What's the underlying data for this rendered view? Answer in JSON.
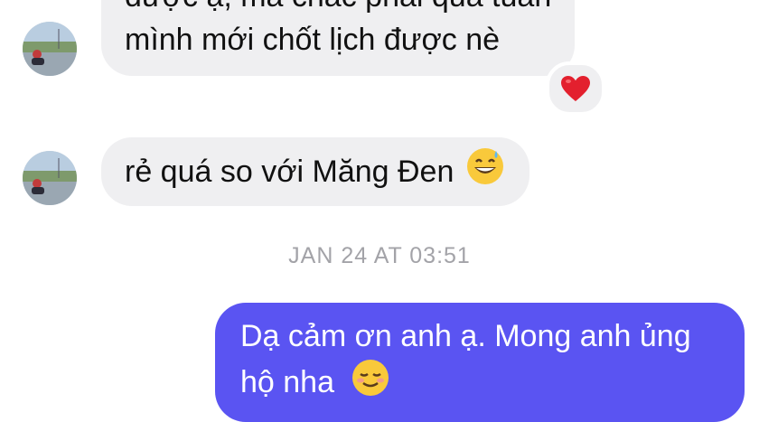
{
  "messages": {
    "first_partial_line": "được ạ, mà chắc phải qua tuần",
    "first_second_line": "mình mới chốt lịch được nè",
    "first_reaction": "heart-emoji",
    "second_text": "rẻ quá so với Măng Đen",
    "second_emoji": "sweat-smile-emoji",
    "timestamp": "JAN 24 AT 03:51",
    "reply_line1": "Dạ cảm ơn anh ạ. Mong anh ủng",
    "reply_line2": "hộ nha",
    "reply_emoji": "smiling-face-emoji"
  },
  "colors": {
    "incoming_bubble": "#efeff1",
    "outgoing_bubble": "#5a54f2",
    "timestamp_text": "#a3a3a8"
  }
}
